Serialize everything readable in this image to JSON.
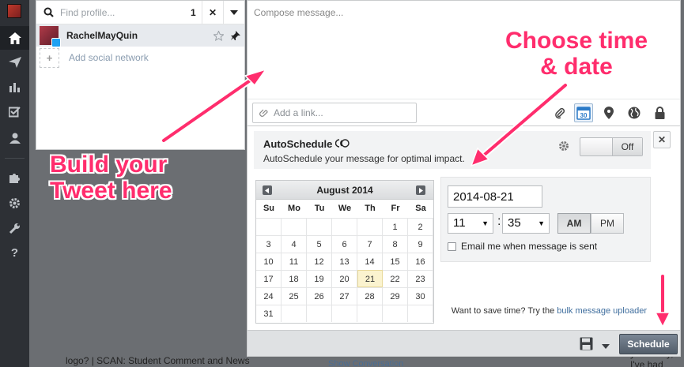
{
  "rail": {
    "items": [
      "home-icon",
      "send-icon",
      "analytics-icon",
      "assignments-icon",
      "contacts-icon",
      "apps-icon",
      "settings-icon",
      "tools-icon",
      "help-icon"
    ]
  },
  "profile_picker": {
    "search_placeholder": "Find profile...",
    "selected_count": "1",
    "clear_label": "✕",
    "profile_name": "RachelMayQuin",
    "add_network_label": "Add social network"
  },
  "compose": {
    "placeholder": "Compose message...",
    "link_placeholder": "Add a link...",
    "calendar_day": "30"
  },
  "autoschedule": {
    "title": "AutoSchedule",
    "description": "AutoSchedule your message for optimal impact.",
    "toggle_label": "Off",
    "close_label": "✕"
  },
  "calendar": {
    "month_label": "August 2014",
    "weekdays": [
      "Su",
      "Mo",
      "Tu",
      "We",
      "Th",
      "Fr",
      "Sa"
    ],
    "weeks": [
      [
        "",
        "",
        "",
        "",
        "",
        "1",
        "2"
      ],
      [
        "3",
        "4",
        "5",
        "6",
        "7",
        "8",
        "9"
      ],
      [
        "10",
        "11",
        "12",
        "13",
        "14",
        "15",
        "16"
      ],
      [
        "17",
        "18",
        "19",
        "20",
        "21",
        "22",
        "23"
      ],
      [
        "24",
        "25",
        "26",
        "27",
        "28",
        "29",
        "30"
      ],
      [
        "31",
        "",
        "",
        "",
        "",
        "",
        ""
      ]
    ],
    "selected_day": "21"
  },
  "datetime": {
    "date_value": "2014-08-21",
    "hour": "11",
    "minute": "35",
    "am_label": "AM",
    "pm_label": "PM",
    "selected_period": "AM",
    "email_label": "Email me when message is sent"
  },
  "bulk": {
    "prefix": "Want to save time? Try the",
    "link": "bulk message uploader"
  },
  "bottom": {
    "schedule_label": "Schedule"
  },
  "annotations": {
    "left_line1": "Build your",
    "left_line2": "Tweet here",
    "right_line1": "Choose time",
    "right_line2": "& date"
  },
  "background": {
    "text1": "logo? | SCAN: Student Comment and News",
    "text2": "Show Conversation",
    "text3": "yesterday, I've had"
  },
  "colors": {
    "annotation": "#ff2d6d",
    "rail": "#2d3035",
    "link": "#3f6e9e"
  }
}
